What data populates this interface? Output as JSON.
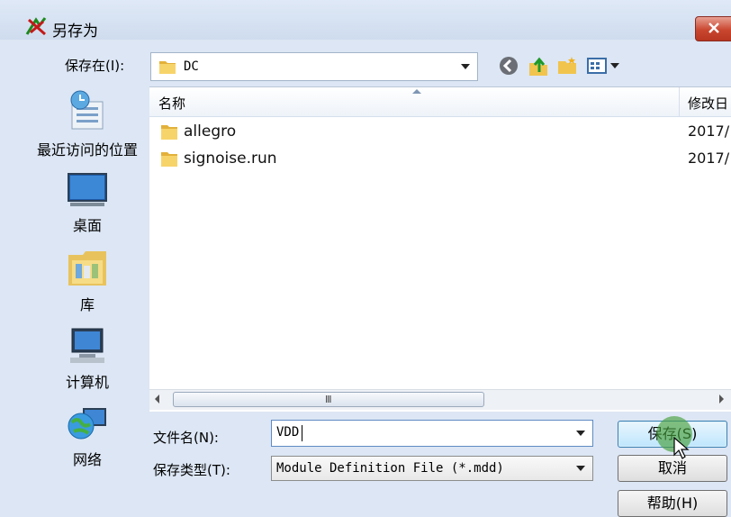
{
  "window": {
    "title": "另存为"
  },
  "toolbar": {
    "save_in_label": "保存在(I):",
    "current_folder": "DC"
  },
  "places": [
    {
      "label": "最近访问的位置",
      "icon": "recent-places-icon"
    },
    {
      "label": "桌面",
      "icon": "desktop-icon"
    },
    {
      "label": "库",
      "icon": "libraries-icon"
    },
    {
      "label": "计算机",
      "icon": "computer-icon"
    },
    {
      "label": "网络",
      "icon": "network-icon"
    }
  ],
  "file_list": {
    "columns": [
      "名称",
      "修改日"
    ],
    "rows": [
      {
        "name": "allegro",
        "date": "2017/"
      },
      {
        "name": "signoise.run",
        "date": "2017/"
      }
    ]
  },
  "form": {
    "filename_label": "文件名(N):",
    "filename_value": "VDD",
    "filetype_label": "保存类型(T):",
    "filetype_value": "Module Definition File (*.mdd)"
  },
  "buttons": {
    "save": "保存(S)",
    "cancel": "取消",
    "help": "帮助(H)"
  },
  "colors": {
    "dialog_bg": "#dce6f4",
    "accent": "#3c7fb1",
    "close": "#c9462f"
  }
}
